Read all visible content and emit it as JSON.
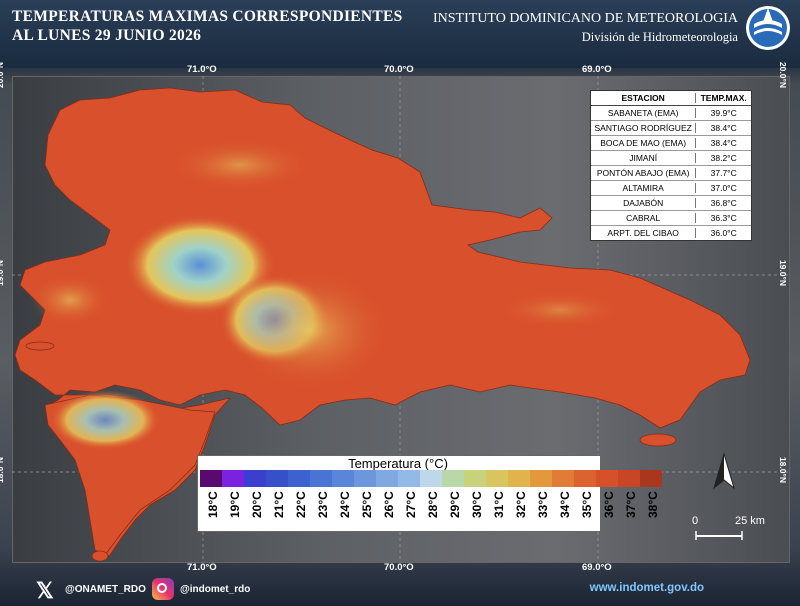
{
  "header": {
    "title_line1": "TEMPERATURAS MAXIMAS CORRESPONDIENTES",
    "title_line2": "AL LUNES 29  JUNIO 2026",
    "institute": "INSTITUTO DOMINICANO DE METEOROLOGIA",
    "division": "División de Hidrometeorologia",
    "logo_icon": "onamet-logo-icon"
  },
  "map": {
    "lon_labels": [
      "71.0°O",
      "70.0°O",
      "69.0°O"
    ],
    "lat_labels": [
      "20.0°N",
      "19.0°N",
      "18.0°N"
    ]
  },
  "stations_table": {
    "header": [
      "ESTACION",
      "TEMP.MAX."
    ],
    "rows": [
      {
        "station": "SABANETA (EMA)",
        "temp": "39.9°C"
      },
      {
        "station": "SANTIAGO RODRÍGUEZ",
        "temp": "38.4°C"
      },
      {
        "station": "BOCA DE MAO (EMA)",
        "temp": "38.4°C"
      },
      {
        "station": "JIMANÍ",
        "temp": "38.2°C"
      },
      {
        "station": "PONTÓN ABAJO (EMA)",
        "temp": "37.7°C"
      },
      {
        "station": "ALTAMIRA",
        "temp": "37.0°C"
      },
      {
        "station": "DAJABÓN",
        "temp": "36.8°C"
      },
      {
        "station": "CABRAL",
        "temp": "36.3°C"
      },
      {
        "station": "ARPT. DEL CIBAO",
        "temp": "36.0°C"
      }
    ]
  },
  "legend": {
    "title": "Temperatura (°C)",
    "labels": [
      "18°C",
      "19°C",
      "20°C",
      "21°C",
      "22°C",
      "23°C",
      "24°C",
      "25°C",
      "26°C",
      "27°C",
      "28°C",
      "29°C",
      "30°C",
      "31°C",
      "32°C",
      "33°C",
      "34°C",
      "35°C",
      "36°C",
      "37°C",
      "38°C"
    ],
    "colors": [
      "#5a0a6e",
      "#7a22e0",
      "#3a3fd0",
      "#3550c8",
      "#3d62cf",
      "#4a74d4",
      "#5a86d9",
      "#6d97dd",
      "#80a9e2",
      "#93bae6",
      "#bcd8ea",
      "#b8d8a8",
      "#c8d27a",
      "#d8c560",
      "#e0b44a",
      "#e3983e",
      "#e07c36",
      "#dc6230",
      "#d6502a",
      "#c84526",
      "#a8371e"
    ]
  },
  "scale_bar": {
    "label_zero": "0",
    "label_dist": "25 km"
  },
  "north_arrow": {
    "icon": "north-arrow-icon"
  },
  "footer": {
    "x_icon": "x-twitter-icon",
    "x_handle": "@ONAMET_RDO",
    "instagram_icon": "instagram-icon",
    "instagram_handle": "@indomet_rdo",
    "website": "www.indomet.gov.do"
  },
  "colors": {
    "land": "#d9512c",
    "highland": "#e7b04a",
    "peak": "#6fa0d8",
    "header_bg": "#1b2b3f"
  }
}
